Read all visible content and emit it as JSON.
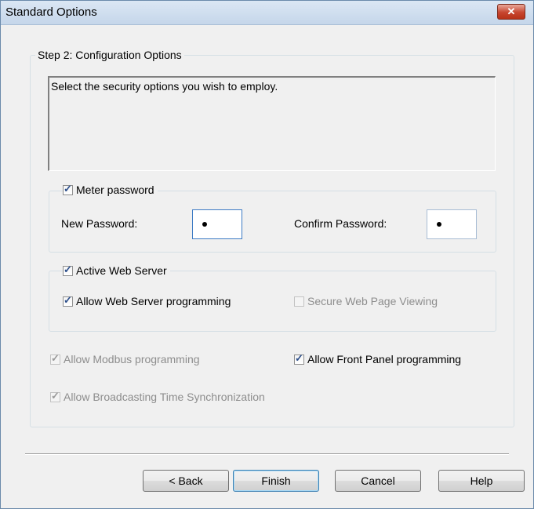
{
  "window": {
    "title": "Standard Options",
    "close_label": "✕"
  },
  "step_group": {
    "legend": "Step 2: Configuration Options",
    "description": "Select the security options you wish to employ."
  },
  "meter_password": {
    "label": "Meter password",
    "checked": true,
    "new_password_label": "New Password:",
    "new_password_value": "•",
    "confirm_password_label": "Confirm Password:",
    "confirm_password_value": "•"
  },
  "web_server": {
    "label": "Active Web Server",
    "checked": true,
    "allow_programming_label": "Allow Web Server programming",
    "allow_programming_checked": true,
    "secure_viewing_label": "Secure Web Page Viewing",
    "secure_viewing_checked": false
  },
  "options": {
    "modbus_label": "Allow Modbus programming",
    "modbus_checked": true,
    "front_panel_label": "Allow Front Panel programming",
    "front_panel_checked": true,
    "broadcast_label": "Allow Broadcasting Time Synchronization",
    "broadcast_checked": true
  },
  "buttons": {
    "back": "< Back",
    "finish": "Finish",
    "cancel": "Cancel",
    "help": "Help"
  },
  "check_mark": "✓"
}
